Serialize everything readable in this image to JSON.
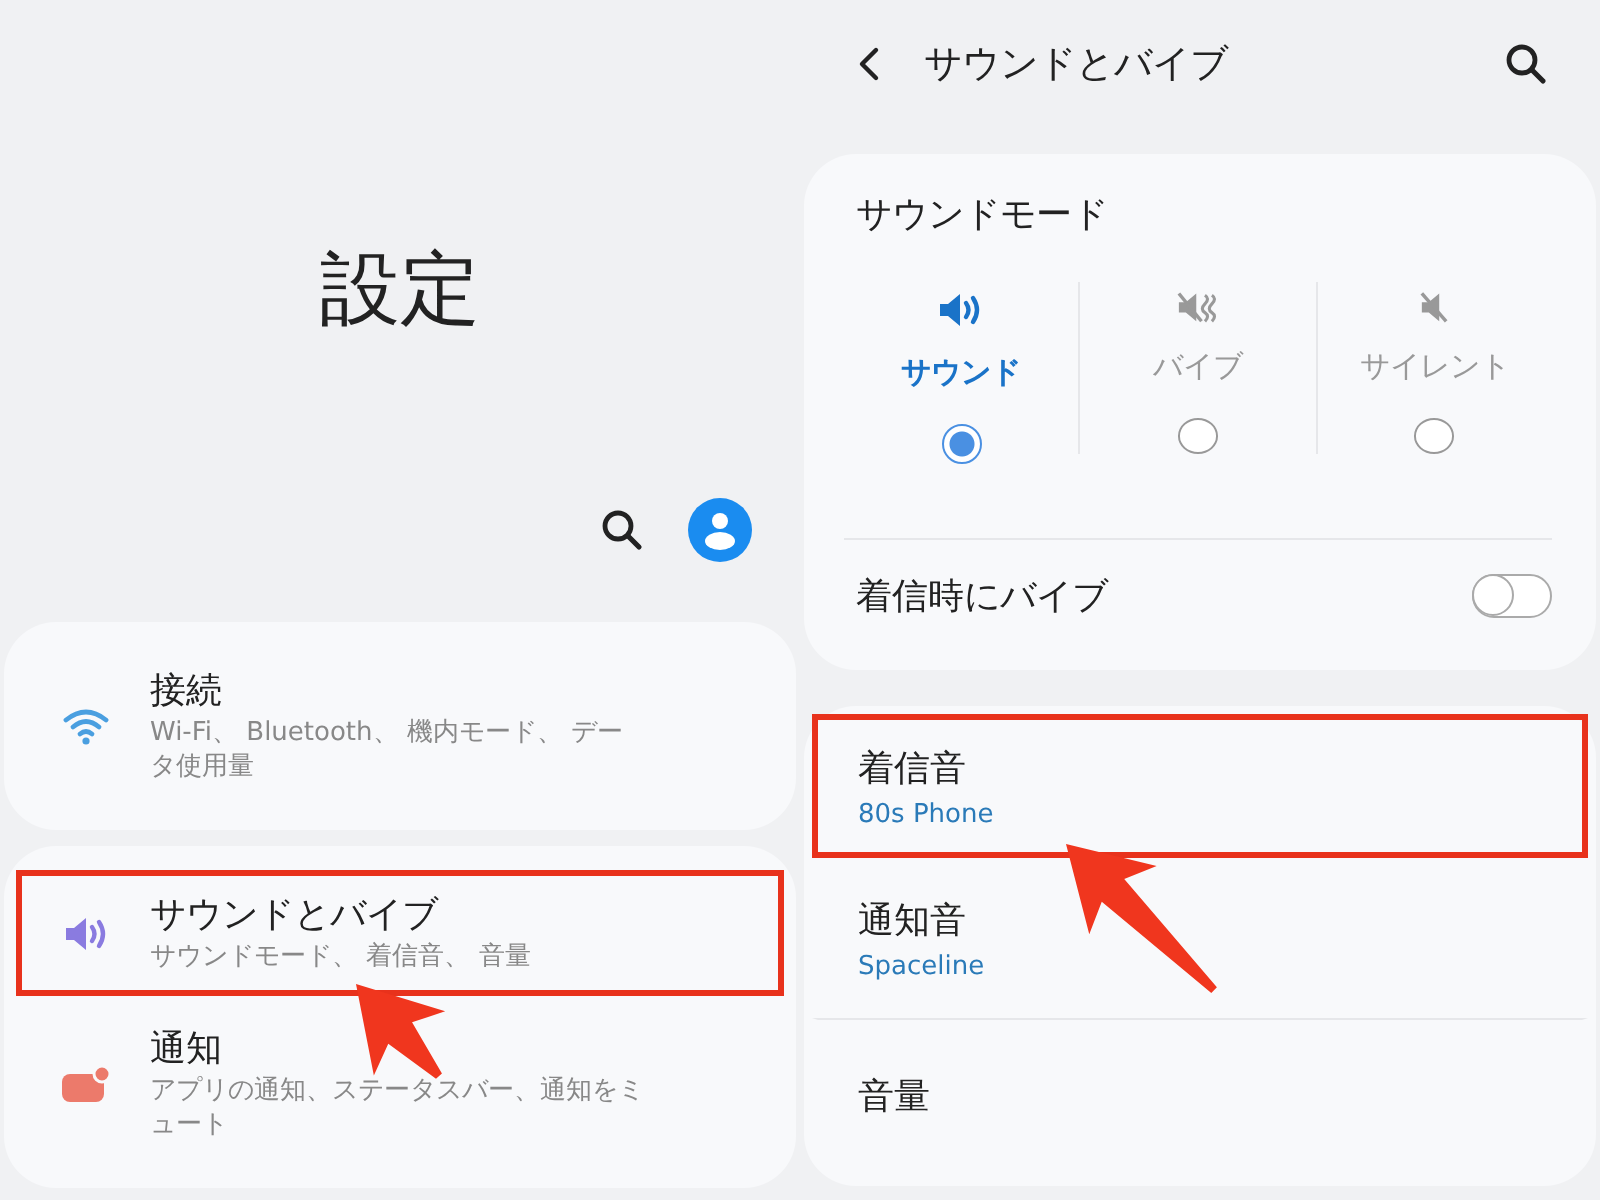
{
  "settings": {
    "title": "設定",
    "cards": [
      {
        "items": [
          {
            "kind": "wifi",
            "title": "接続",
            "subtitle": "Wi-Fi、 Bluetooth、 機内モード、 データ使用量",
            "highlighted": false
          }
        ]
      },
      {
        "items": [
          {
            "kind": "sound",
            "title": "サウンドとバイブ",
            "subtitle": "サウンドモード、 着信音、 音量",
            "highlighted": true
          },
          {
            "kind": "notification",
            "title": "通知",
            "subtitle": "アプリの通知、ステータスバー、通知をミュート",
            "highlighted": false
          }
        ]
      }
    ]
  },
  "sound": {
    "title": "サウンドとバイブ",
    "sound_mode": {
      "title": "サウンドモード",
      "modes": [
        {
          "kind": "sound",
          "label": "サウンド",
          "selected": true
        },
        {
          "kind": "vibrate",
          "label": "バイブ",
          "selected": false
        },
        {
          "kind": "silent",
          "label": "サイレント",
          "selected": false
        }
      ]
    },
    "vibrate_on_call": {
      "label": "着信時にバイブ",
      "on": false
    },
    "items": [
      {
        "title": "着信音",
        "value": "80s Phone",
        "highlighted": true
      },
      {
        "title": "通知音",
        "value": "Spaceline",
        "highlighted": false
      },
      {
        "title": "音量",
        "highlighted": false
      }
    ]
  }
}
